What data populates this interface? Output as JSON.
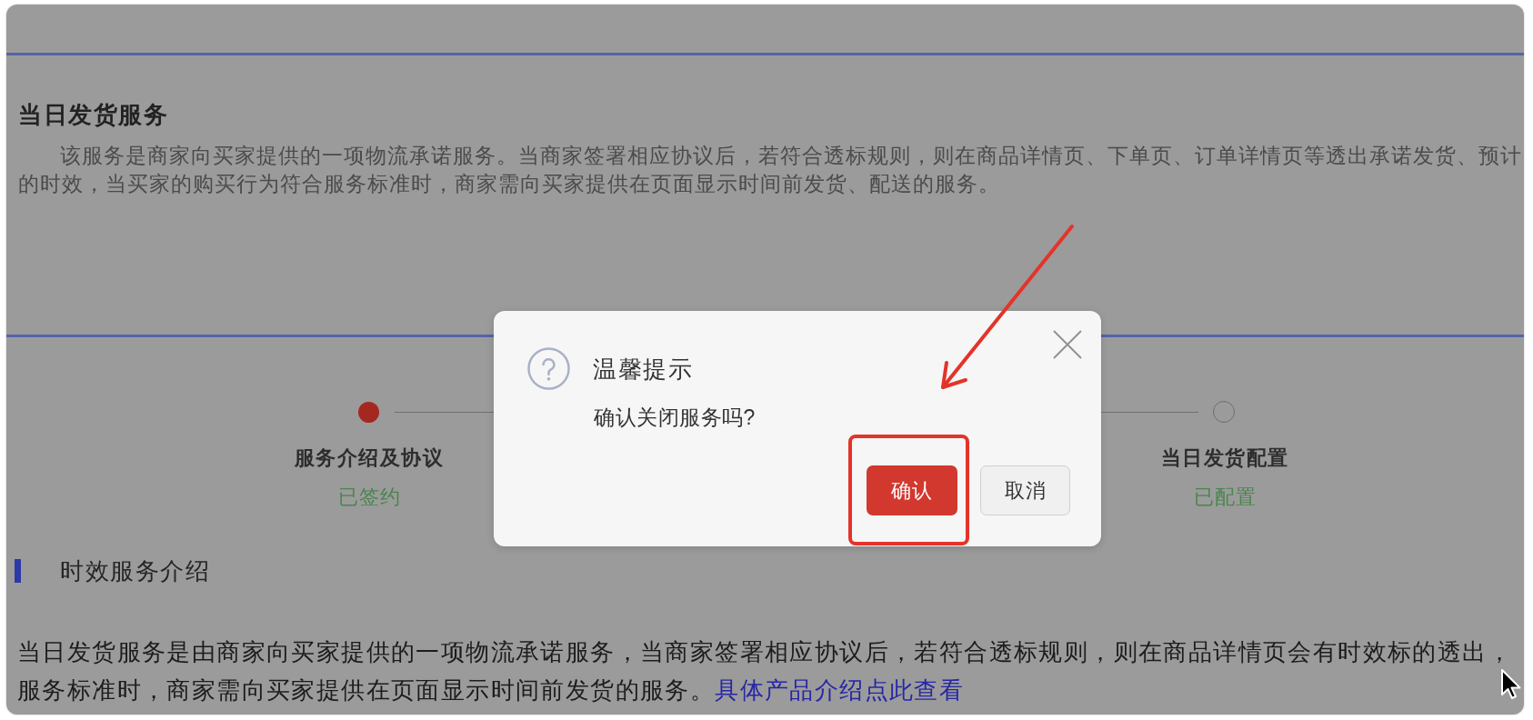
{
  "page": {
    "title": "当日发货服务",
    "description_lines": [
      "该服务是商家向买家提供的一项物流承诺服务。当商家签署相应协议后，若符合透标规则，则在商品详情页、下单页、订单详情页等透出承诺发货、预计",
      "的时效，当买家的购买行为符合服务标准时，商家需向买家提供在页面显示时间前发货、配送的服务。"
    ]
  },
  "steps": [
    {
      "title": "服务介绍及协议",
      "status": "已签约",
      "current": true
    },
    {
      "title": "当日发货配置",
      "status": "已配置",
      "current": false
    }
  ],
  "section": {
    "heading": "时效服务介绍",
    "lines": [
      {
        "text": "当日发货服务是由商家向买家提供的一项物流承诺服务，当商家签署相应协议后，若符合透标规则，则在商品详情页会有时效标的透出，"
      },
      {
        "text": "服务标准时，商家需向买家提供在页面显示时间前发货的服务。",
        "link": "具体产品介绍点此查看"
      }
    ]
  },
  "dialog": {
    "title": "温馨提示",
    "message": "确认关闭服务吗?",
    "buttons": [
      {
        "label": "确认",
        "kind": "primary"
      },
      {
        "label": "取消",
        "kind": "default"
      }
    ]
  }
}
